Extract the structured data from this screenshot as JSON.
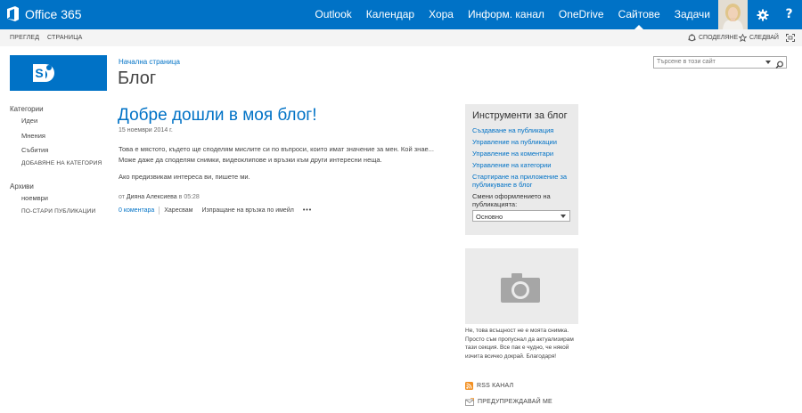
{
  "suite": {
    "app_name": "Office 365",
    "nav": [
      {
        "label": "Outlook",
        "active": false
      },
      {
        "label": "Календар",
        "active": false
      },
      {
        "label": "Хора",
        "active": false
      },
      {
        "label": "Информ. канал",
        "active": false
      },
      {
        "label": "OneDrive",
        "active": false
      },
      {
        "label": "Сайтове",
        "active": true
      },
      {
        "label": "Задачи",
        "active": false
      }
    ],
    "settings_icon": "gear-icon",
    "help_glyph": "?"
  },
  "ribbon": {
    "tabs": [
      "ПРЕГЛЕД",
      "СТРАНИЦА"
    ],
    "share_label": "СПОДЕЛЯНЕ",
    "follow_label": "СЛЕДВАЙ"
  },
  "site": {
    "breadcrumb": "Начална страница",
    "title": "Блог",
    "search_placeholder": "Търсене в този сайт"
  },
  "leftnav": {
    "categories_heading": "Категории",
    "categories": [
      "Идеи",
      "Мнения",
      "Събития"
    ],
    "add_category": "ДОБАВЯНЕ НА КАТЕГОРИЯ",
    "archives_heading": "Архиви",
    "archives": [
      "ноември"
    ],
    "older_posts": "ПО-СТАРИ ПУБЛИКАЦИИ"
  },
  "post": {
    "title": "Добре дошли в моя блог!",
    "date": "15 ноември 2014 г.",
    "body": "Това е мястото, където ще споделям мислите си по въпроси, които имат значение за мен. Кой знае... Може даже да споделям снимки, видеоклипове и връзки към други интересни неща.",
    "body2": "Ако предизвикам интереса ви, пишете ми.",
    "author_prefix": "от",
    "author": "Дияна Алексиева",
    "time_prefix": "в",
    "time": "05:28",
    "comments": "0 коментара",
    "like": "Харесвам",
    "email_link": "Изпращане на връзка по имейл",
    "more": "•••"
  },
  "tools": {
    "title": "Инструменти за блог",
    "links": [
      "Създаване на публикация",
      "Управление на публикации",
      "Управление на коментари",
      "Управление на категории",
      "Стартиране на приложение за публикуване в блог"
    ],
    "layout_label": "Смени оформлението на публикацията:",
    "layout_value": "Основно"
  },
  "photo_caption": "Не, това всъщност не е моята снимка. Просто съм пропуснал да актуализирам тази секция. Все пак е чудно, че някой изчита всичко докрай. Благодаря!",
  "feeds": {
    "rss": "RSS КАНАЛ",
    "alert": "ПРЕДУПРЕЖДАВАЙ МЕ"
  },
  "colors": {
    "brand": "#0072c6",
    "ribbon_bg": "#f4f4f4",
    "panel_bg": "#eaeaea"
  }
}
